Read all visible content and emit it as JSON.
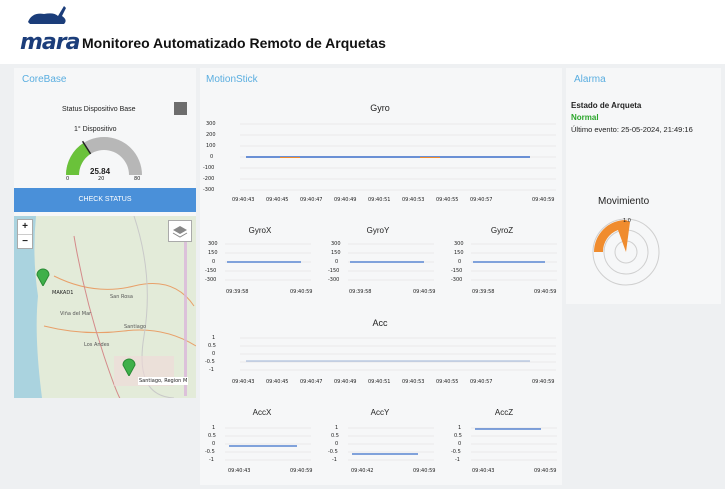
{
  "app": {
    "title": "Monitoreo Automatizado Remoto de Arquetas",
    "logo_text": "mara",
    "logo_icon": "rabbit-icon"
  },
  "corebase": {
    "panel_title": "CoreBase",
    "status_label": "Status Dispositivo Base",
    "device_label": "1° Dispositivo",
    "gauge_value": "25.84",
    "gauge_min": "0",
    "gauge_mid": "20",
    "gauge_max": "80",
    "gauge_fraction": 0.32,
    "check_button": "CHECK STATUS",
    "map": {
      "zoom_in": "+",
      "zoom_out": "−",
      "marker1_label": "MAKAD1",
      "marker2_label": "Santiago, Region M",
      "place_labels": [
        "San Rosa",
        "Viña del Mar",
        "Santiago",
        "Los Andes"
      ]
    }
  },
  "motionstick": {
    "panel_title": "MotionStick",
    "gyro": {
      "title": "Gyro",
      "y_ticks": [
        "300",
        "200",
        "100",
        "0",
        "-100",
        "-200",
        "-300"
      ],
      "x_ticks": [
        "09:40:43",
        "09:40:45",
        "09:40:47",
        "09:40:49",
        "09:40:51",
        "09:40:53",
        "09:40:55",
        "09:40:57",
        "09:40:59"
      ]
    },
    "gyro_small": [
      {
        "title": "GyroX",
        "y_ticks": [
          "300",
          "150",
          "0",
          "-150",
          "-300"
        ],
        "x_ticks": [
          "09:39:58",
          "09:40:59"
        ]
      },
      {
        "title": "GyroY",
        "y_ticks": [
          "300",
          "150",
          "0",
          "-150",
          "-300"
        ],
        "x_ticks": [
          "09:39:58",
          "09:40:59"
        ]
      },
      {
        "title": "GyroZ",
        "y_ticks": [
          "300",
          "150",
          "0",
          "-150",
          "-300"
        ],
        "x_ticks": [
          "09:39:58",
          "09:40:59"
        ]
      }
    ],
    "acc": {
      "title": "Acc",
      "y_ticks": [
        "1",
        "0.5",
        "0",
        "-0.5",
        "-1"
      ],
      "x_ticks": [
        "09:40:43",
        "09:40:45",
        "09:40:47",
        "09:40:49",
        "09:40:51",
        "09:40:53",
        "09:40:55",
        "09:40:57",
        "09:40:59"
      ]
    },
    "acc_small": [
      {
        "title": "AccX",
        "y_ticks": [
          "1",
          "0.5",
          "0",
          "-0.5",
          "-1"
        ],
        "x_ticks": [
          "09:40:43",
          "09:40:59"
        ]
      },
      {
        "title": "AccY",
        "y_ticks": [
          "1",
          "0.5",
          "0",
          "-0.5",
          "-1"
        ],
        "x_ticks": [
          "09:40:42",
          "09:40:59"
        ]
      },
      {
        "title": "AccZ",
        "y_ticks": [
          "1",
          "0.5",
          "0",
          "-0.5",
          "-1"
        ],
        "x_ticks": [
          "09:40:43",
          "09:40:59"
        ]
      }
    ]
  },
  "alarma": {
    "panel_title": "Alarma",
    "estado_label": "Estado de Arqueta",
    "estado_value": "Normal",
    "ultimo_evento": "Último evento: 25-05-2024, 21:49:16",
    "movimiento_title": "Movimiento",
    "radar_tick": "1.0"
  },
  "colors": {
    "accent_blue": "#5aaee0",
    "button_blue": "#4a90d9",
    "status_green": "#2aa52a",
    "line_blue": "#3b6fc9",
    "orange": "#f08c2e",
    "gauge_green": "#6ac23a"
  }
}
